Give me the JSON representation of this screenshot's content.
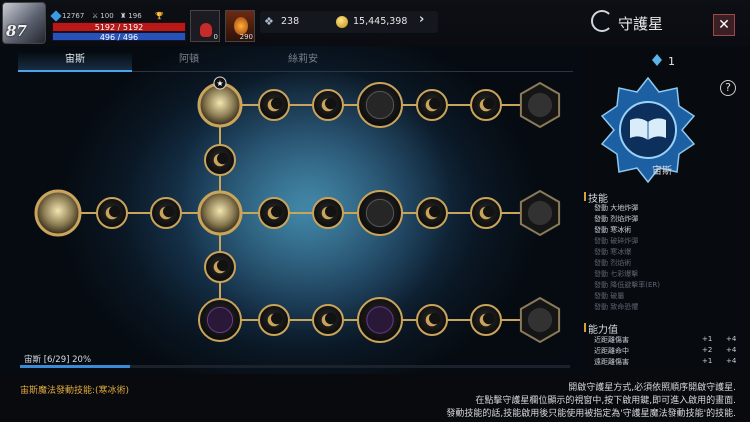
{
  "player": {
    "level": "87",
    "gems": "12767",
    "swords": "100",
    "power": "196",
    "hp": "5192 / 5192",
    "mp": "496 / 496"
  },
  "items": {
    "potion_count": "0",
    "elixir_count": "290"
  },
  "currency": {
    "crystals": "238",
    "gold": "15,445,398"
  },
  "header": {
    "title": "守護星",
    "close_label": "✕"
  },
  "tabs": [
    {
      "label": "宙斯"
    },
    {
      "label": "阿頓"
    },
    {
      "label": "絲莉安"
    }
  ],
  "constellation": {
    "name": "宙斯",
    "points": "1",
    "help": "?"
  },
  "skills": {
    "heading": "技能",
    "list": [
      {
        "name": "發動 大地炸彈",
        "active": true
      },
      {
        "name": "發動 烈焰炸彈",
        "active": true
      },
      {
        "name": "發動 寒冰術",
        "active": true
      },
      {
        "name": "發動 破碎炸彈",
        "active": false
      },
      {
        "name": "發動 寒冰爆",
        "active": false
      },
      {
        "name": "發動 烈焰術",
        "active": false
      },
      {
        "name": "發動 七彩爆擊",
        "active": false
      },
      {
        "name": "發動 降低避擊率(ER)",
        "active": false
      },
      {
        "name": "發動 破屬",
        "active": false
      },
      {
        "name": "發動 致命恐懼",
        "active": false
      }
    ]
  },
  "powers": {
    "heading": "能力值",
    "list": [
      {
        "name": "近距離傷害",
        "current": "+1",
        "next": "+4"
      },
      {
        "name": "近距離命中",
        "current": "+2",
        "next": "+4"
      },
      {
        "name": "遠距離傷害",
        "current": "+1",
        "next": "+4"
      }
    ]
  },
  "progress": {
    "label": "宙斯 [6/29] 20%",
    "value": 0.2
  },
  "footer": {
    "magic_skill": "宙斯魔法發動技能:(寒冰術)",
    "info_lines": [
      "開啟守護星方式,必須依照順序開啟守護星.",
      "在點擊守護星欄位顯示的視窗中,按下啟用鍵,即可進入啟用的畫面.",
      "發動技能的話,技能啟用後只能使用被指定為'守護星魔法發動技能'的技能."
    ]
  },
  "colors": {
    "accent": "#4aa6e8",
    "gold": "#d2a23a",
    "hp": "#b71818",
    "mp": "#2952b8"
  }
}
